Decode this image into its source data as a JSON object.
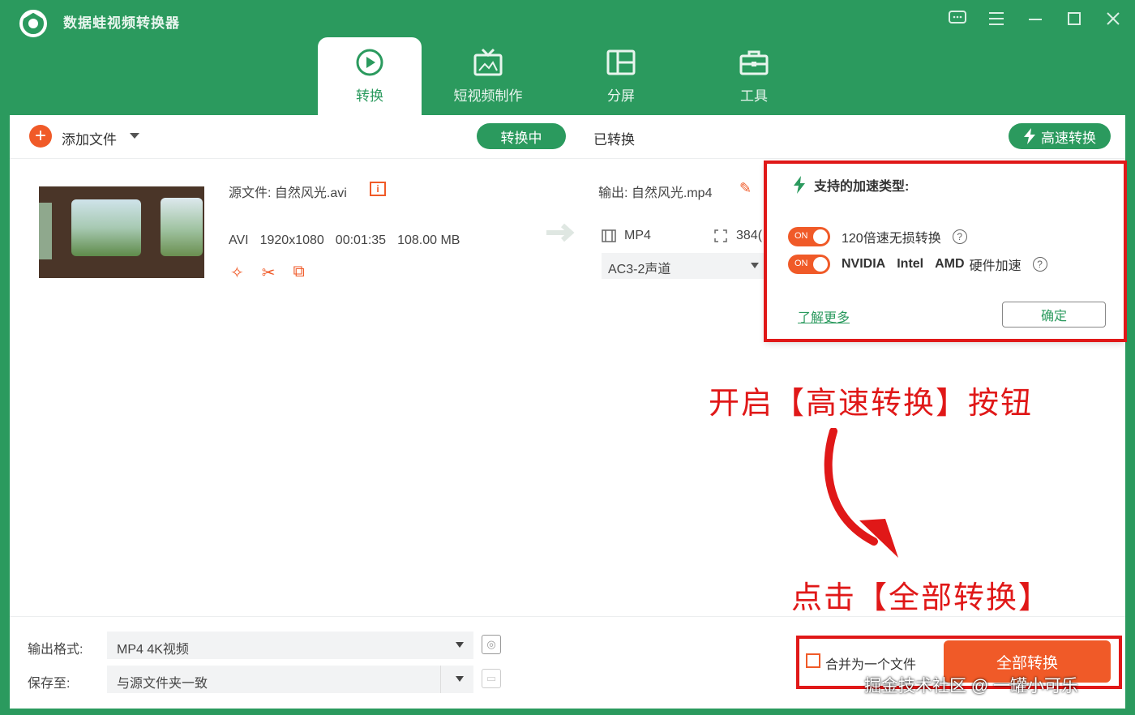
{
  "app": {
    "title": "数据蛙视频转换器"
  },
  "window_controls": [
    "chat-icon",
    "menu-icon",
    "minimize-icon",
    "maximize-icon",
    "close-icon"
  ],
  "tabs": [
    {
      "label": "转换",
      "icon": "convert-icon",
      "active": true
    },
    {
      "label": "短视频制作",
      "icon": "tv-icon",
      "active": false
    },
    {
      "label": "分屏",
      "icon": "split-screen-icon",
      "active": false
    },
    {
      "label": "工具",
      "icon": "toolbox-icon",
      "active": false
    }
  ],
  "toolbar": {
    "add_file": "添加文件",
    "converting": "转换中",
    "converted": "已转换",
    "high_speed": "高速转换"
  },
  "file": {
    "source_label": "源文件:",
    "source_name": "自然风光.avi",
    "format": "AVI",
    "resolution": "1920x1080",
    "duration": "00:01:35",
    "size": "108.00 MB",
    "output_label": "输出:",
    "output_name": "自然风光.mp4",
    "output_format": "MP4",
    "output_resolution": "384(",
    "audio": "AC3-2声道"
  },
  "speed_popup": {
    "title": "支持的加速类型:",
    "toggle_text": "ON",
    "option1": "120倍速无损转换",
    "option2_brands": [
      "NVIDIA",
      "Intel",
      "AMD"
    ],
    "option2_suffix": "硬件加速",
    "learn_more": "了解更多",
    "ok": "确定"
  },
  "annotations": {
    "step1": "开启【高速转换】按钮",
    "step2": "点击【全部转换】"
  },
  "bottom": {
    "output_format_label": "输出格式:",
    "output_format_value": "MP4 4K视频",
    "save_to_label": "保存至:",
    "save_to_value": "与源文件夹一致",
    "merge_label": "合并为一个文件",
    "convert_all": "全部转换"
  },
  "watermark": "掘金技术社区 @ 一罐小可乐",
  "colors": {
    "brand": "#2b9a5e",
    "accent": "#f05a28",
    "annotation": "#e01818"
  }
}
